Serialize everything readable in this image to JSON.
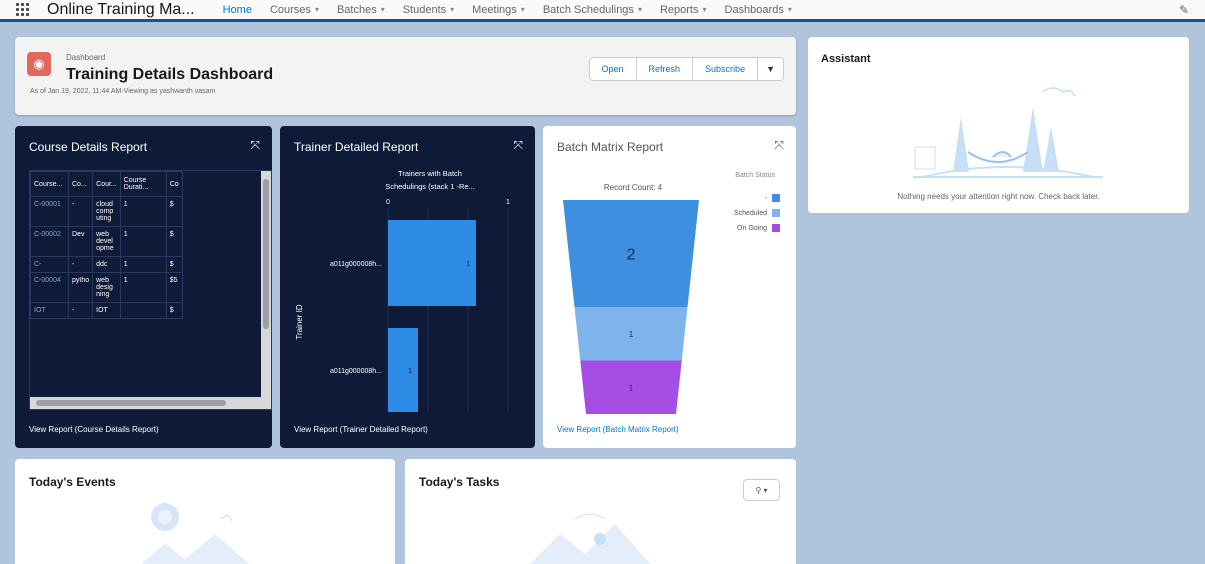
{
  "nav": {
    "app_name": "Online Training Ma...",
    "items": [
      {
        "label": "Home",
        "active": true,
        "chevron": false
      },
      {
        "label": "Courses",
        "chevron": true
      },
      {
        "label": "Batches",
        "chevron": true
      },
      {
        "label": "Students",
        "chevron": true
      },
      {
        "label": "Meetings",
        "chevron": true
      },
      {
        "label": "Batch Schedulings",
        "chevron": true
      },
      {
        "label": "Reports",
        "chevron": true
      },
      {
        "label": "Dashboards",
        "chevron": true
      }
    ]
  },
  "header": {
    "crumb": "Dashboard",
    "title": "Training Details Dashboard",
    "subtitle": "As of Jan 19, 2022, 11:44 AM·Viewing as yashwanth vasam",
    "buttons": {
      "open": "Open",
      "refresh": "Refresh",
      "subscribe": "Subscribe"
    }
  },
  "course_report": {
    "title": "Course Details Report",
    "headers": [
      "Course...",
      "Co...",
      "Cour...",
      "Course Durati...",
      "Co"
    ],
    "rows": [
      [
        "C-00001",
        "-",
        "cloud comp uting",
        "1",
        "$"
      ],
      [
        "C-00002",
        "Dev",
        "web devel opme",
        "1",
        "$"
      ],
      [
        "C-",
        "-",
        "ddc",
        "1",
        "$"
      ],
      [
        "C-00004",
        "pytho",
        "web desig ning",
        "1",
        "$5"
      ],
      [
        "IOT",
        "-",
        "IOT",
        "",
        "$"
      ]
    ],
    "link": "View Report (Course Details Report)"
  },
  "trainer_report": {
    "title": "Trainer Detailed Report",
    "link": "View Report (Trainer Detailed Report)"
  },
  "batch_report": {
    "title": "Batch Matrix Report",
    "link": "View Report (Batch Matrix Report)"
  },
  "chart_data": [
    {
      "type": "bar",
      "orientation": "horizontal",
      "title": "Trainers with Batch Schedulings (stack 1 -Re...",
      "ylabel": "Trainer ID",
      "categories": [
        "a011g000008h...",
        "a011g000008h..."
      ],
      "values": [
        1,
        1
      ],
      "xlim": [
        0,
        1
      ],
      "ticks": [
        "0",
        "",
        "",
        "1"
      ],
      "colors": [
        "#2e8ce6",
        "#2e8ce6"
      ]
    },
    {
      "type": "funnel",
      "title": "Record Count: 4",
      "legend_title": "Batch Status",
      "legend": [
        {
          "name": "-",
          "color": "#3d8fe0"
        },
        {
          "name": "Scheduled",
          "color": "#7fb3ec"
        },
        {
          "name": "On Going",
          "color": "#a44ee5"
        }
      ],
      "categories": [
        "-",
        "Scheduled",
        "On Going"
      ],
      "values": [
        2,
        1,
        1
      ]
    }
  ],
  "assistant": {
    "title": "Assistant",
    "message": "Nothing needs your attention right now. Check back later."
  },
  "events": {
    "title": "Today's Events"
  },
  "tasks": {
    "title": "Today's Tasks"
  }
}
